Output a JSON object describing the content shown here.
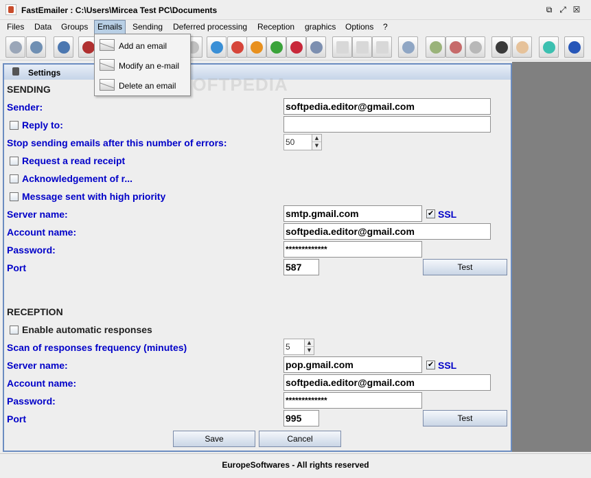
{
  "window": {
    "title": "FastEmailer : C:\\Users\\Mircea Test PC\\Documents"
  },
  "menu": [
    "Files",
    "Data",
    "Groups",
    "Emails",
    "Sending",
    "Deferred processing",
    "Reception",
    "graphics",
    "Options",
    "?"
  ],
  "emails_menu": [
    "Add an email",
    "Modify an e-mail",
    "Delete an email"
  ],
  "settings": {
    "title": "Settings",
    "sending": {
      "heading": "SENDING",
      "sender_label": "Sender:",
      "sender_value": "softpedia.editor@gmail.com",
      "reply_to_label": "Reply to:",
      "reply_to_value": "",
      "stop_after_errors_label": "Stop sending emails after this number of errors:",
      "stop_after_errors_value": "50",
      "read_receipt_label": "Request a read receipt",
      "acknowledgement_label": "Acknowledgement of r...",
      "high_priority_label": "Message sent with high priority",
      "server_label": "Server name:",
      "server_value": "smtp.gmail.com",
      "ssl_label": "SSL",
      "account_label": "Account name:",
      "account_value": "softpedia.editor@gmail.com",
      "password_label": "Password:",
      "password_value": "*************",
      "port_label": "Port",
      "port_value": "587",
      "test_label": "Test"
    },
    "reception": {
      "heading": "RECEPTION",
      "auto_responses_label": "Enable automatic responses",
      "scan_frequency_label": "Scan of responses frequency (minutes)",
      "scan_frequency_value": "5",
      "server_label": "Server name:",
      "server_value": "pop.gmail.com",
      "ssl_label": "SSL",
      "account_label": "Account name:",
      "account_value": "softpedia.editor@gmail.com",
      "password_label": "Password:",
      "password_value": "*************",
      "port_label": "Port",
      "port_value": "995",
      "test_label": "Test"
    },
    "save_label": "Save",
    "cancel_label": "Cancel"
  },
  "status": "EuropeSoftwares - All rights reserved",
  "watermark": "SOFTPEDIA"
}
